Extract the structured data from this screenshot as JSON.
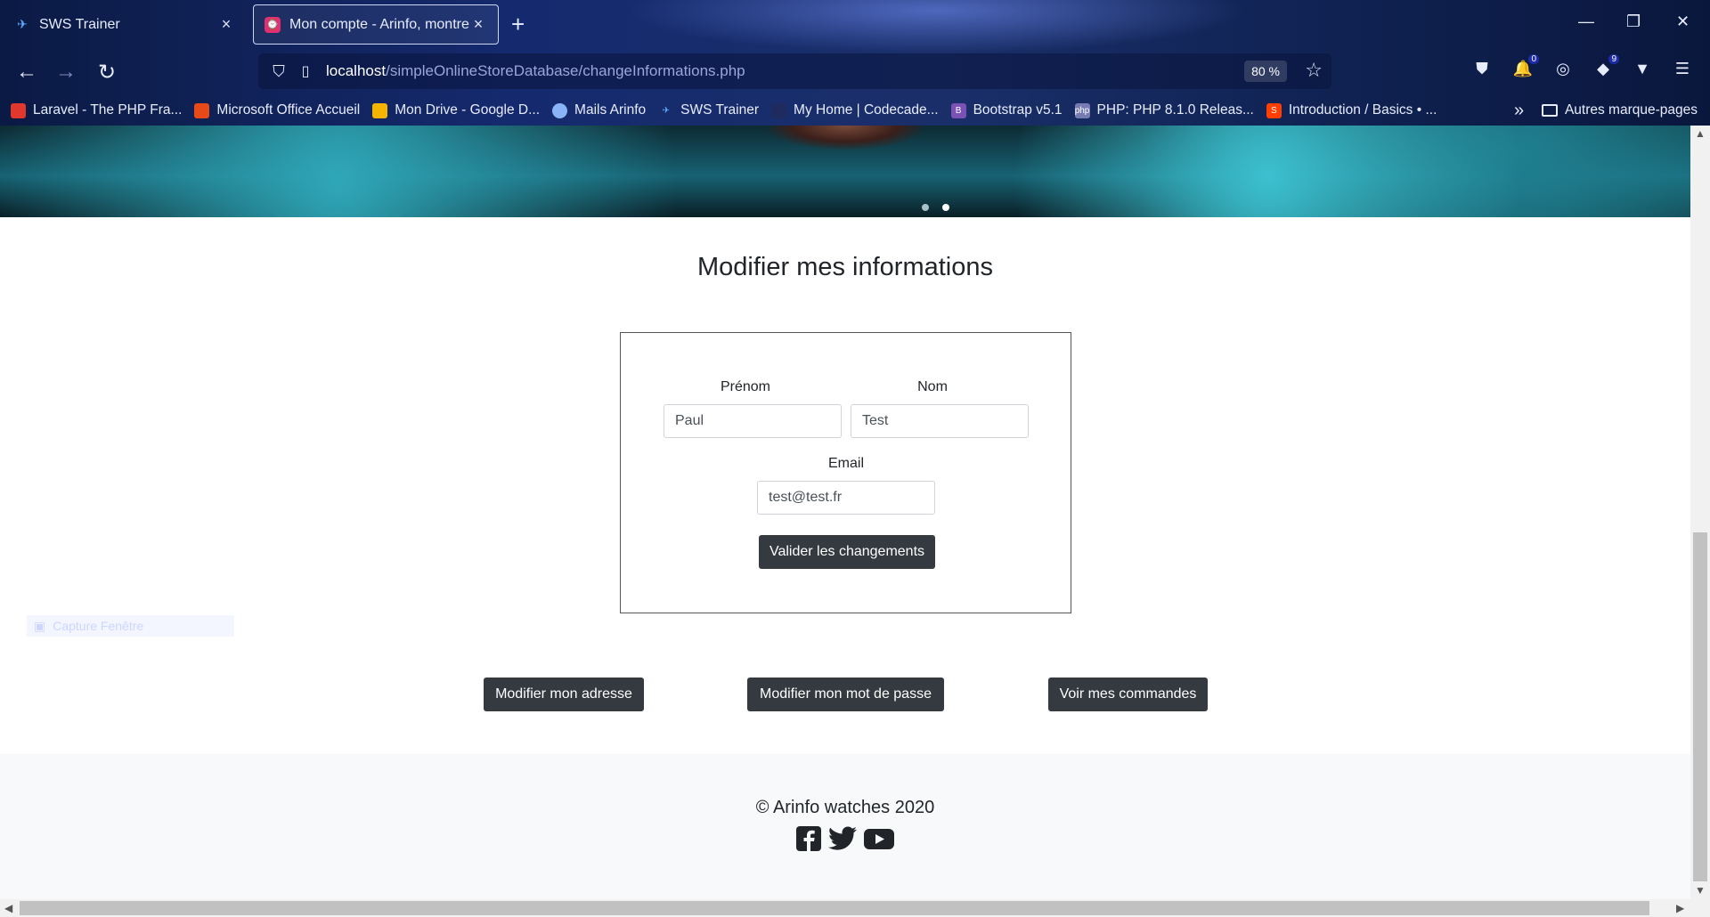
{
  "browser": {
    "tabs": [
      {
        "title": "SWS Trainer",
        "active": false
      },
      {
        "title": "Mon compte - Arinfo, montres i",
        "active": true
      }
    ],
    "url_host": "localhost",
    "url_path": "/simpleOnlineStoreDatabase/changeInformations.php",
    "zoom": "80 %",
    "extension_badges": {
      "first": "0",
      "second": "9"
    },
    "bookmarks": [
      {
        "label": "Laravel - The PHP Fra...",
        "color": "#e2372d"
      },
      {
        "label": "Microsoft Office Accueil",
        "color": "#e64a19"
      },
      {
        "label": "Mon Drive - Google D...",
        "color": "#f4b400"
      },
      {
        "label": "Mails Arinfo",
        "color": "#8ab4f8"
      },
      {
        "label": "SWS Trainer",
        "color": "#5fb0ff"
      },
      {
        "label": "My Home | Codecade...",
        "color": "#1f2b5e"
      },
      {
        "label": "Bootstrap v5.1",
        "color": "#7952b3"
      },
      {
        "label": "PHP: PHP 8.1.0 Releas...",
        "color": "#777bb3"
      },
      {
        "label": "Introduction / Basics • ...",
        "color": "#ff3e00"
      }
    ],
    "other_bookmarks": "Autres marque-pages"
  },
  "page": {
    "title": "Modifier mes informations",
    "form": {
      "firstname_label": "Prénom",
      "firstname_value": "Paul",
      "lastname_label": "Nom",
      "lastname_value": "Test",
      "email_label": "Email",
      "email_value": "test@test.fr",
      "submit_label": "Valider les changements"
    },
    "actions": {
      "address": "Modifier mon adresse",
      "password": "Modifier mon mot de passe",
      "orders": "Voir mes commandes"
    },
    "overlay_text": "Capture Fenêtre",
    "footer": {
      "copyright": "© Arinfo watches 2020",
      "social_icons": [
        "facebook-icon",
        "twitter-icon",
        "youtube-icon"
      ]
    }
  }
}
